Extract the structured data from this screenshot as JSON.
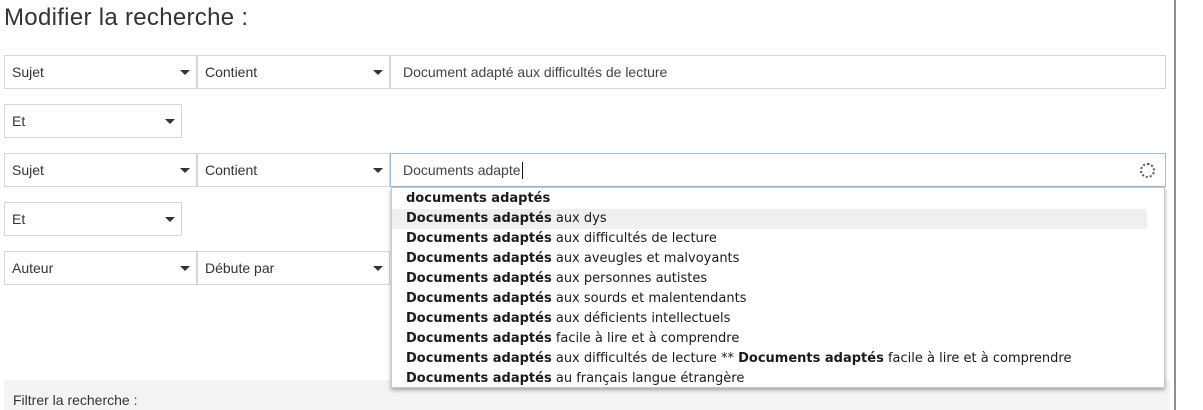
{
  "title": "Modifier la recherche :",
  "rows": [
    {
      "field": "Sujet",
      "operator": "Contient",
      "value": "Document adapté aux difficultés de lecture"
    },
    {
      "boolean": "Et"
    },
    {
      "field": "Sujet",
      "operator": "Contient",
      "value": "Documents adapte"
    },
    {
      "boolean": "Et"
    },
    {
      "field": "Auteur",
      "operator": "Débute par"
    }
  ],
  "suggestions": [
    {
      "bold": "documents adaptés",
      "rest": ""
    },
    {
      "bold": "Documents adaptés",
      "rest": " aux dys"
    },
    {
      "bold": "Documents adaptés",
      "rest": " aux difficultés de lecture"
    },
    {
      "bold": "Documents adaptés",
      "rest": " aux aveugles et malvoyants"
    },
    {
      "bold": "Documents adaptés",
      "rest": " aux personnes autistes"
    },
    {
      "bold": "Documents adaptés",
      "rest": " aux sourds et malentendants"
    },
    {
      "bold": "Documents adaptés",
      "rest": " aux déficients intellectuels"
    },
    {
      "bold": "Documents adaptés",
      "rest": " facile à lire et à comprendre"
    },
    {
      "bold": "Documents adaptés",
      "rest": " aux difficultés de lecture ** ",
      "bold2": "Documents adaptés",
      "rest2": " facile à lire et à comprendre"
    },
    {
      "bold": "Documents adaptés",
      "rest": " au français langue étrangère"
    }
  ],
  "highlighted_suggestion": 1,
  "filter": {
    "label": "Filtrer la recherche :"
  },
  "icons": {
    "caret": "chevron-down-icon",
    "loading": "spinner-icon"
  }
}
